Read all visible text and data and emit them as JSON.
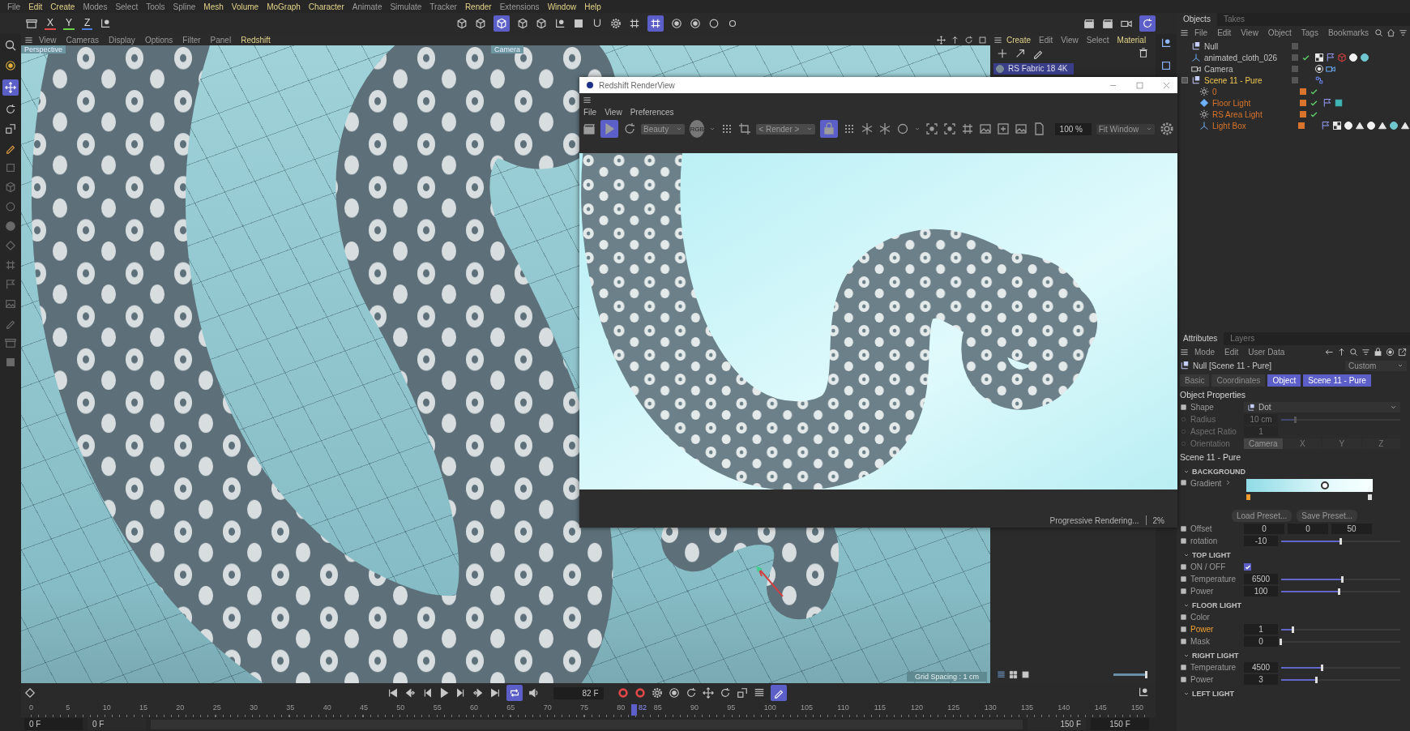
{
  "menu_bar": [
    {
      "label": "File",
      "highlighted": false
    },
    {
      "label": "Edit",
      "highlighted": true
    },
    {
      "label": "Create",
      "highlighted": true
    },
    {
      "label": "Modes",
      "highlighted": false
    },
    {
      "label": "Select",
      "highlighted": false
    },
    {
      "label": "Tools",
      "highlighted": false
    },
    {
      "label": "Spline",
      "highlighted": false
    },
    {
      "label": "Mesh",
      "highlighted": true
    },
    {
      "label": "Volume",
      "highlighted": true
    },
    {
      "label": "MoGraph",
      "highlighted": true
    },
    {
      "label": "Character",
      "highlighted": true
    },
    {
      "label": "Animate",
      "highlighted": false
    },
    {
      "label": "Simulate",
      "highlighted": false
    },
    {
      "label": "Tracker",
      "highlighted": false
    },
    {
      "label": "Render",
      "highlighted": true
    },
    {
      "label": "Extensions",
      "highlighted": false
    },
    {
      "label": "Window",
      "highlighted": true
    },
    {
      "label": "Help",
      "highlighted": true
    }
  ],
  "toolbar": {
    "axes": [
      "X",
      "Y",
      "Z"
    ]
  },
  "viewport": {
    "menu": [
      {
        "label": "View",
        "highlighted": false
      },
      {
        "label": "Cameras",
        "highlighted": false
      },
      {
        "label": "Display",
        "highlighted": false
      },
      {
        "label": "Options",
        "highlighted": false
      },
      {
        "label": "Filter",
        "highlighted": false
      },
      {
        "label": "Panel",
        "highlighted": false
      },
      {
        "label": "Redshift",
        "highlighted": true
      }
    ],
    "view_name": "Perspective",
    "camera_name": "Camera",
    "grid_info": "Grid Spacing : 1 cm"
  },
  "material_manager": {
    "menu": [
      {
        "label": "Create",
        "highlighted": true
      },
      {
        "label": "Edit",
        "highlighted": false
      },
      {
        "label": "View",
        "highlighted": false
      },
      {
        "label": "Select",
        "highlighted": false
      },
      {
        "label": "Material",
        "highlighted": true
      }
    ],
    "materials": [
      {
        "name": "RS Fabric 18 4K",
        "selected": true
      }
    ],
    "zoom": {
      "level": 1
    }
  },
  "objects_panel": {
    "tabs": [
      {
        "label": "Objects",
        "selected": true
      },
      {
        "label": "Takes",
        "selected": false
      }
    ],
    "menu": [
      "File",
      "Edit",
      "View",
      "Object",
      "Tags",
      "Bookmarks"
    ],
    "tree": [
      {
        "name": "Null",
        "kind": "null",
        "selected": false,
        "enabled": false
      },
      {
        "name": "animated_cloth_026",
        "kind": "cloth",
        "selected": false,
        "enabled": true,
        "tags": [
          {
            "kind": "checker"
          },
          {
            "kind": "flag"
          },
          {
            "kind": "red-cube"
          },
          {
            "kind": "sphere"
          },
          {
            "kind": "sphere-blue"
          }
        ]
      },
      {
        "name": "Camera",
        "kind": "camera",
        "selected": false,
        "enabled": false,
        "tags": [
          {
            "kind": "target"
          },
          {
            "kind": "camera"
          }
        ]
      },
      {
        "name": "Scene 11 - Pure",
        "kind": "null",
        "selected": true,
        "enabled": false,
        "expanded": true,
        "tags": [
          {
            "kind": "xpresso"
          }
        ],
        "children": [
          {
            "name": "0",
            "kind": "light",
            "selected": false,
            "enabled": true,
            "color": "#d9742c"
          },
          {
            "name": "Floor Light",
            "kind": "area-light",
            "selected": false,
            "enabled": true,
            "color": "#d9742c",
            "tags": [
              {
                "kind": "flag"
              },
              {
                "kind": "swatch"
              }
            ]
          },
          {
            "name": "RS Area Light",
            "kind": "light",
            "selected": false,
            "enabled": true,
            "color": "#d9742c"
          },
          {
            "name": "Light Box",
            "kind": "cloth",
            "selected": false,
            "enabled": false,
            "color": "#d9742c",
            "tags": [
              {
                "kind": "flag"
              },
              {
                "kind": "checker"
              },
              {
                "kind": "sphere"
              },
              {
                "kind": "triangle"
              },
              {
                "kind": "sphere"
              },
              {
                "kind": "triangle"
              },
              {
                "kind": "sphere-blue"
              },
              {
                "kind": "triangle"
              }
            ]
          }
        ]
      }
    ]
  },
  "render_view": {
    "title": "Redshift RenderView",
    "menu": [
      "File",
      "View",
      "Preferences"
    ],
    "aov": "Beauty",
    "channel": "RGB",
    "camera": "< Render >",
    "zoom": "100 %",
    "fit": "Fit Window",
    "status": "Progressive Rendering...",
    "progress": "2%"
  },
  "attributes": {
    "tabs": [
      {
        "label": "Attributes",
        "selected": true
      },
      {
        "label": "Layers",
        "selected": false
      }
    ],
    "menu": [
      "Mode",
      "Edit",
      "User Data"
    ],
    "object_title": "Null [Scene 11 - Pure]",
    "mode": "Custom",
    "sub_tabs": [
      {
        "label": "Basic",
        "selected": false
      },
      {
        "label": "Coordinates",
        "selected": false
      },
      {
        "label": "Object",
        "selected": true
      },
      {
        "label": "Scene 11 - Pure",
        "selected": true
      }
    ],
    "object_properties": {
      "title": "Object Properties",
      "params": [
        {
          "kind": "dropdown",
          "label": "Shape",
          "value": "Dot",
          "disabled": false
        },
        {
          "kind": "slider",
          "label": "Radius",
          "value": "10 cm",
          "level": 0.12,
          "disabled": true
        },
        {
          "kind": "number",
          "label": "Aspect Ratio",
          "value": "1",
          "disabled": true
        },
        {
          "kind": "segmented",
          "label": "Orientation",
          "options": [
            {
              "label": "Camera",
              "selected": true
            },
            {
              "label": "X",
              "selected": false
            },
            {
              "label": "Y",
              "selected": false
            },
            {
              "label": "Z",
              "selected": false
            }
          ],
          "disabled": true
        }
      ]
    },
    "user_data": {
      "title": "Scene 11 - Pure",
      "groups": [
        {
          "title": "BACKGROUND",
          "expanded": true,
          "params": [
            {
              "kind": "gradient",
              "label": "Gradient",
              "highlighted": false
            },
            {
              "kind": "buttons",
              "buttons": [
                "Load Preset...",
                "Save Preset..."
              ],
              "highlighted": false
            },
            {
              "kind": "vector",
              "label": "Offset",
              "values": [
                "0",
                "0",
                "50"
              ],
              "highlighted": false
            },
            {
              "kind": "slider",
              "label": "rotation",
              "value": "-10",
              "level": 0.5,
              "highlighted": false
            }
          ]
        },
        {
          "title": "TOP LIGHT",
          "expanded": true,
          "params": [
            {
              "kind": "checkbox",
              "label": "ON / OFF",
              "checked": true,
              "highlighted": false
            },
            {
              "kind": "slider",
              "label": "Temperature",
              "value": "6500",
              "level": 0.52,
              "highlighted": false
            },
            {
              "kind": "slider",
              "label": "Power",
              "value": "100",
              "level": 0.49,
              "highlighted": false
            }
          ]
        },
        {
          "title": "FLOOR LIGHT",
          "expanded": true,
          "params": [
            {
              "kind": "color",
              "label": "Color",
              "highlighted": false
            },
            {
              "kind": "slider",
              "label": "Power",
              "value": "1",
              "level": 0.1,
              "highlighted": true
            },
            {
              "kind": "slider",
              "label": "Mask",
              "value": "0",
              "level": 0,
              "highlighted": false
            }
          ]
        },
        {
          "title": "RIGHT LIGHT",
          "expanded": true,
          "params": [
            {
              "kind": "slider",
              "label": "Temperature",
              "value": "4500",
              "level": 0.35,
              "highlighted": false
            },
            {
              "kind": "slider",
              "label": "Power",
              "value": "3",
              "level": 0.3,
              "highlighted": false
            }
          ]
        },
        {
          "title": "LEFT LIGHT",
          "expanded": true
        }
      ]
    }
  },
  "timeline": {
    "ruler": [
      "0",
      "5",
      "10",
      "15",
      "20",
      "25",
      "30",
      "35",
      "40",
      "45",
      "50",
      "55",
      "60",
      "65",
      "70",
      "75",
      "80",
      "85",
      "90",
      "95",
      "100",
      "105",
      "110",
      "115",
      "120",
      "125",
      "130",
      "135",
      "140",
      "145",
      "150"
    ],
    "current": "82",
    "playhead": {
      "level": 0.547
    },
    "current_frame": "82 F",
    "start": "0 F",
    "preview_start": "0 F",
    "preview_end": "150 F",
    "end": "150 F"
  }
}
